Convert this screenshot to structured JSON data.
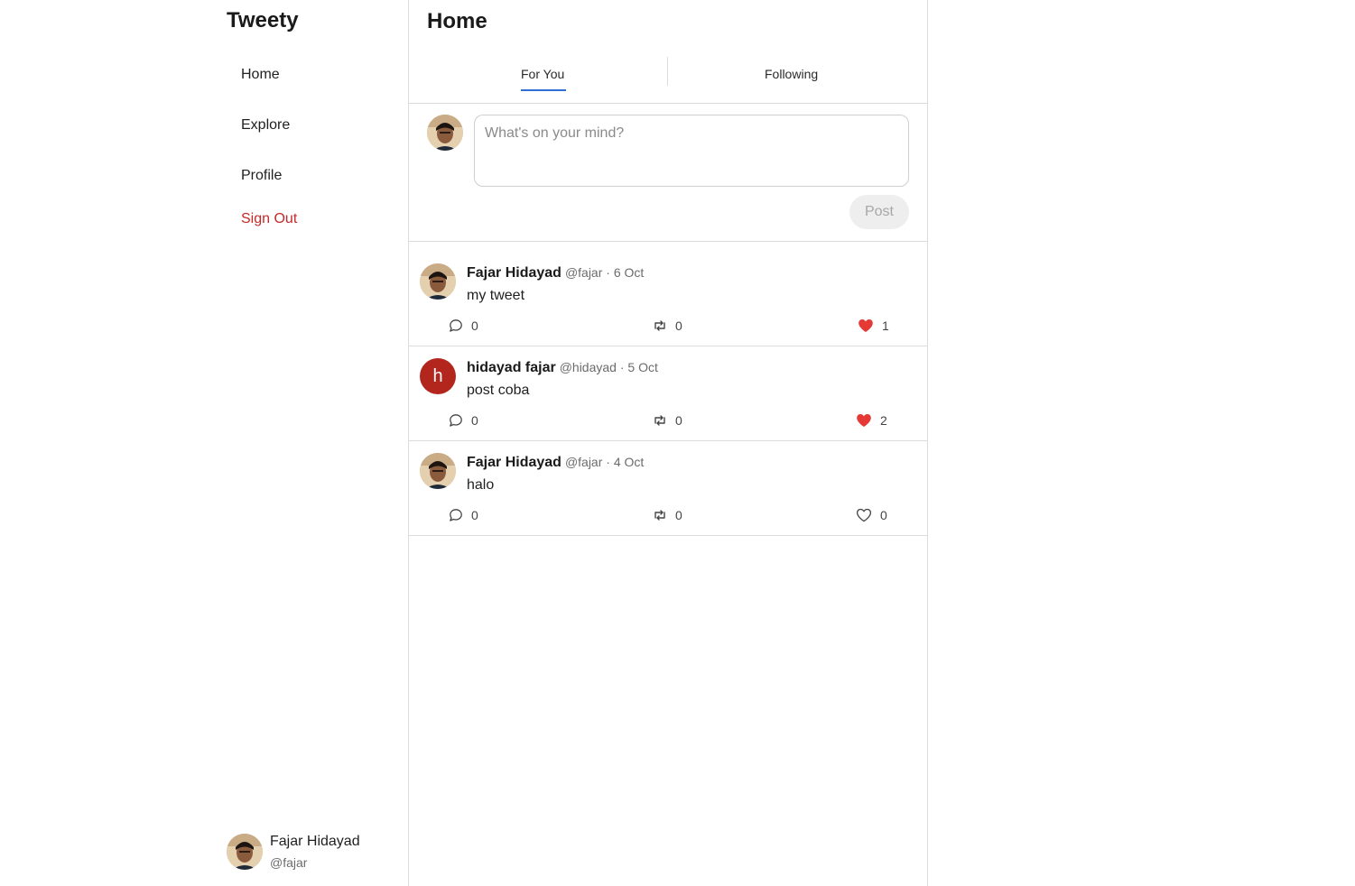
{
  "app": {
    "brand": "Tweety"
  },
  "nav": {
    "home": "Home",
    "explore": "Explore",
    "profile": "Profile",
    "sign_out": "Sign Out"
  },
  "current_user": {
    "name": "Fajar Hidayad",
    "handle": "@fajar"
  },
  "main": {
    "title": "Home",
    "tabs": [
      {
        "label": "For You",
        "active": true
      },
      {
        "label": "Following",
        "active": false
      }
    ]
  },
  "composer": {
    "placeholder": "What's on your mind?",
    "post_label": "Post"
  },
  "feed": [
    {
      "name": "Fajar Hidayad",
      "meta": "@fajar · 6 Oct",
      "text": "my tweet",
      "replies": "0",
      "reposts": "0",
      "likes": "1",
      "liked": true,
      "avatar": "photo"
    },
    {
      "name": "hidayad fajar",
      "meta": "@hidayad · 5 Oct",
      "text": "post coba",
      "replies": "0",
      "reposts": "0",
      "likes": "2",
      "liked": true,
      "avatar": "h"
    },
    {
      "name": "Fajar Hidayad",
      "meta": "@fajar · 4 Oct",
      "text": "halo",
      "replies": "0",
      "reposts": "0",
      "likes": "0",
      "liked": false,
      "avatar": "photo"
    }
  ],
  "colors": {
    "accent": "#2f6fd6",
    "danger": "#c62828",
    "like": "#e53935",
    "letter_avatar": "#b3261e"
  }
}
